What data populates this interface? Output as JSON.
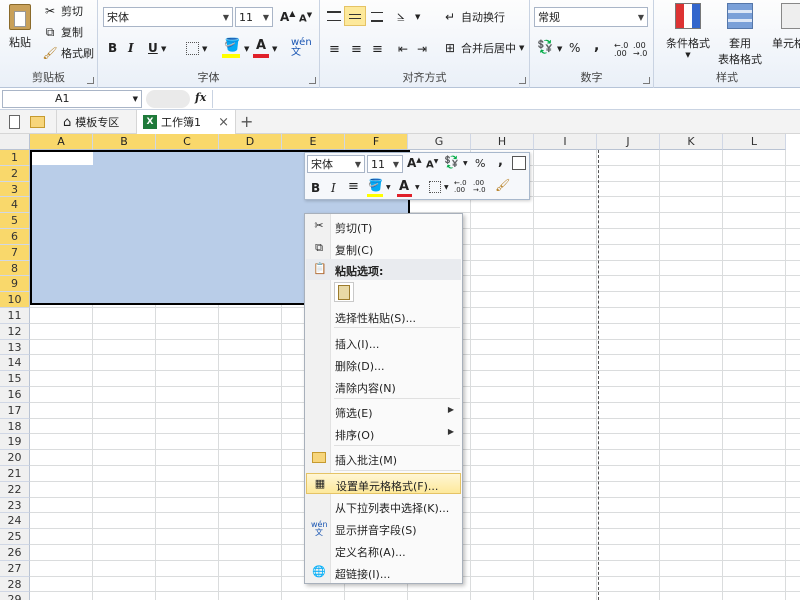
{
  "ribbon": {
    "clipboard": {
      "paste": "粘贴",
      "cut": "剪切",
      "copy": "复制",
      "format_painter": "格式刷",
      "label": "剪贴板"
    },
    "font": {
      "name": "宋体",
      "size": "11",
      "bold": "B",
      "italic": "I",
      "underline": "U",
      "label": "字体"
    },
    "alignment": {
      "wrap_text": "自动换行",
      "merge_center": "合并后居中",
      "label": "对齐方式"
    },
    "number": {
      "format": "常规",
      "percent": "%",
      "comma": ",",
      "label": "数字"
    },
    "styles": {
      "conditional": "条件格式",
      "table_format_1": "套用",
      "table_format_2": "表格格式",
      "cell_styles": "单元格格",
      "label": "样式"
    }
  },
  "formula_bar": {
    "name_box": "A1",
    "fx": "fx",
    "value": ""
  },
  "tabs": {
    "template": "模板专区",
    "workbook": "工作簿1",
    "close": "×",
    "add": "+"
  },
  "grid": {
    "columns": [
      "A",
      "B",
      "C",
      "D",
      "E",
      "F",
      "G",
      "H",
      "I",
      "J",
      "K",
      "L"
    ],
    "rows": [
      "1",
      "2",
      "3",
      "4",
      "5",
      "6",
      "7",
      "8",
      "9",
      "10",
      "11",
      "12",
      "13",
      "14",
      "15",
      "16",
      "17",
      "18",
      "19",
      "20",
      "21",
      "22",
      "23",
      "24",
      "25",
      "26",
      "27",
      "28",
      "29"
    ],
    "selected_cols": [
      "A",
      "B",
      "C",
      "D",
      "E",
      "F"
    ],
    "selected_rows_count": 10
  },
  "mini_toolbar": {
    "font": "宋体",
    "size": "11",
    "bold": "B",
    "italic": "I",
    "percent": "%",
    "comma": ","
  },
  "context_menu": {
    "cut": "剪切(T)",
    "copy": "复制(C)",
    "paste_options": "粘贴选项:",
    "paste_special": "选择性粘贴(S)...",
    "insert": "插入(I)...",
    "delete": "删除(D)...",
    "clear_contents": "清除内容(N)",
    "filter": "筛选(E)",
    "sort": "排序(O)",
    "insert_comment": "插入批注(M)",
    "format_cells": "设置单元格格式(F)...",
    "pick_from_list": "从下拉列表中选择(K)...",
    "phonetic": "显示拼音字段(S)",
    "define_name": "定义名称(A)...",
    "hyperlink": "超链接(I)..."
  },
  "colors": {
    "accent": "#f9d86b",
    "selection": "#b9cde8",
    "highlight": "#fde99b"
  }
}
